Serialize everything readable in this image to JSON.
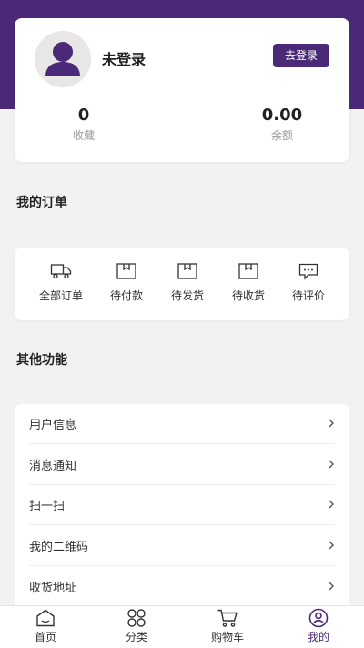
{
  "profile": {
    "username": "未登录",
    "login_button": "去登录",
    "favorites_count": "0",
    "favorites_label": "收藏",
    "balance_value": "0.00",
    "balance_label": "余额"
  },
  "orders": {
    "title": "我的订单",
    "items": [
      {
        "label": "全部订单",
        "icon": "truck-icon"
      },
      {
        "label": "待付款",
        "icon": "box-icon"
      },
      {
        "label": "待发货",
        "icon": "box-icon"
      },
      {
        "label": "待收货",
        "icon": "box-icon"
      },
      {
        "label": "待评价",
        "icon": "comment-icon"
      }
    ]
  },
  "functions": {
    "title": "其他功能",
    "items": [
      {
        "label": "用户信息"
      },
      {
        "label": "消息通知"
      },
      {
        "label": "扫一扫"
      },
      {
        "label": "我的二维码"
      },
      {
        "label": "收货地址"
      }
    ]
  },
  "tabbar": {
    "items": [
      {
        "label": "首页",
        "icon": "home-icon"
      },
      {
        "label": "分类",
        "icon": "grid-icon"
      },
      {
        "label": "购物车",
        "icon": "cart-icon"
      },
      {
        "label": "我的",
        "icon": "user-circle-icon",
        "active": true
      }
    ]
  },
  "colors": {
    "accent": "#4a2a78",
    "background": "#f4f2f1"
  }
}
